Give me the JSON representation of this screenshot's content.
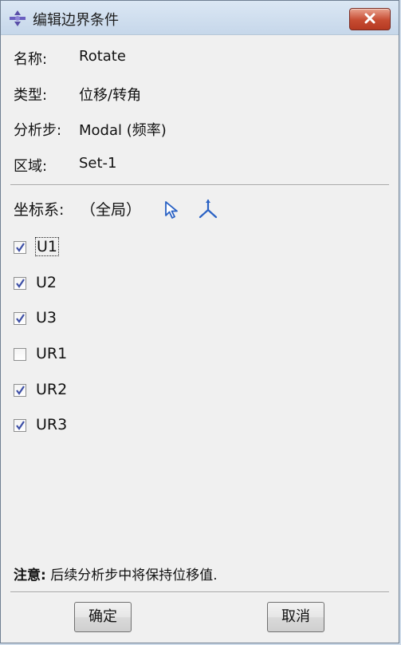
{
  "window": {
    "title": "编辑边界条件"
  },
  "fields": {
    "name_label": "名称:",
    "name_value": "Rotate",
    "type_label": "类型:",
    "type_value": "位移/转角",
    "step_label": "分析步:",
    "step_value": "Modal (频率)",
    "region_label": "区域:",
    "region_value": "Set-1"
  },
  "csys": {
    "label": "坐标系:",
    "value": "（全局）"
  },
  "dofs": [
    {
      "label": "U1",
      "checked": true
    },
    {
      "label": "U2",
      "checked": true
    },
    {
      "label": "U3",
      "checked": true
    },
    {
      "label": "UR1",
      "checked": false
    },
    {
      "label": "UR2",
      "checked": true
    },
    {
      "label": "UR3",
      "checked": true
    }
  ],
  "note": {
    "prefix": "注意:",
    "text": "后续分析步中将保持位移值."
  },
  "buttons": {
    "ok": "确定",
    "cancel": "取消"
  },
  "colors": {
    "titlebar": "#c6d7ea",
    "close_button": "#c64b31",
    "checkmark": "#3d4fa6",
    "icon_blue": "#2a62c4"
  }
}
